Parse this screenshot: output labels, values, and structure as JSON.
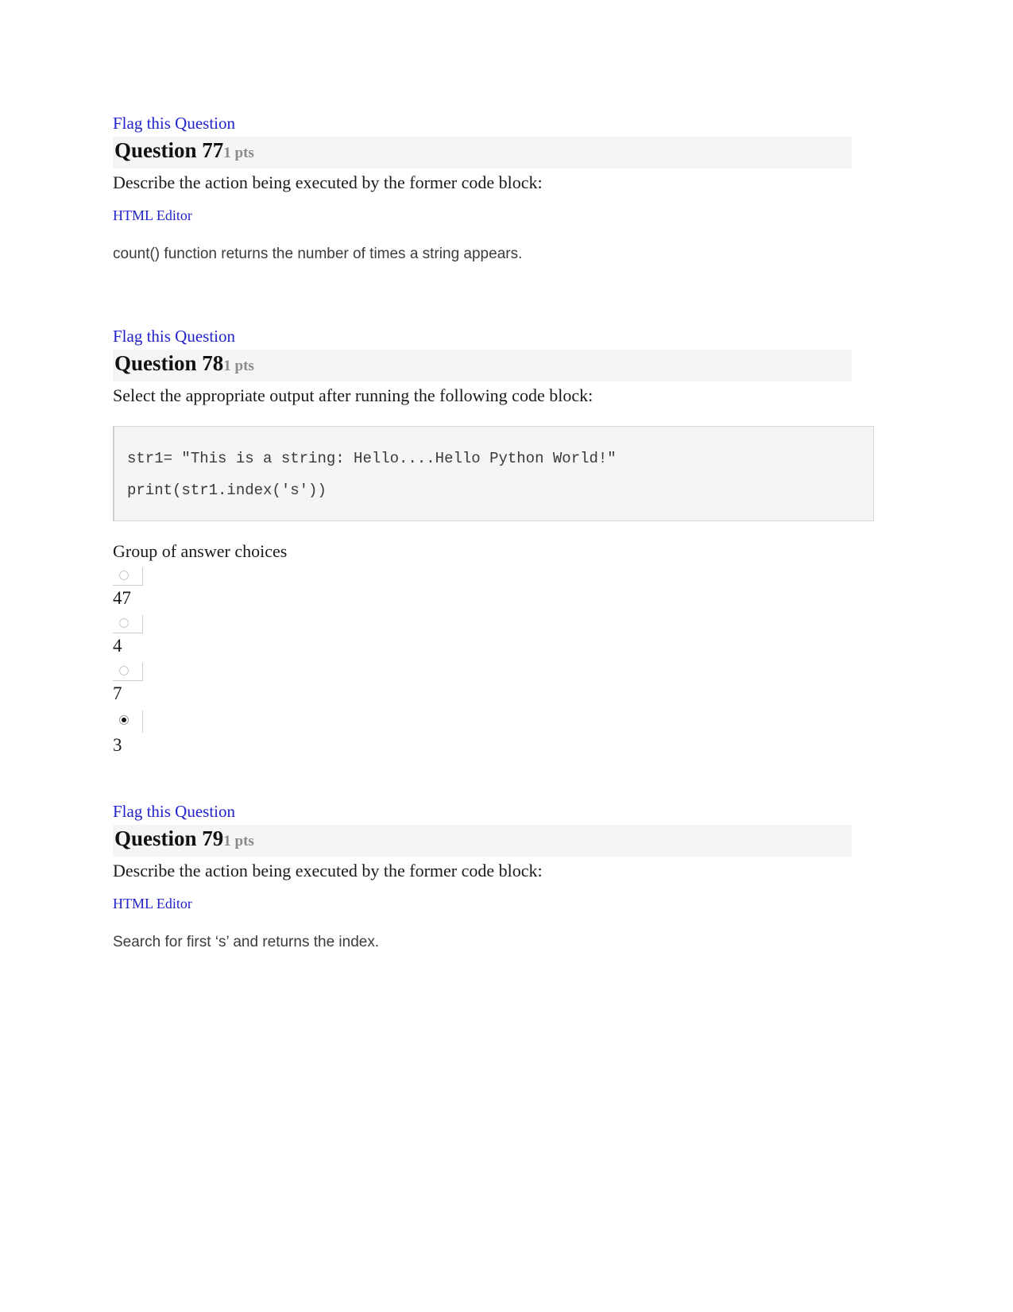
{
  "page": {
    "background": "#ffffff",
    "link_color": "#2222cc",
    "header_bar_color": "#f5f5f5",
    "points_color": "#8a8a8a",
    "code_bg": "#f5f5f5",
    "code_border": "#d8d8d8"
  },
  "questions": [
    {
      "flag_label": "Flag this Question",
      "title": "Question 77",
      "points": "1 pts",
      "prompt": "Describe the action being executed by the former code block:",
      "editor_label": "HTML Editor",
      "answer": "count() function returns the number of times a string appears."
    },
    {
      "flag_label": "Flag this Question",
      "title": "Question 78",
      "points": "1 pts",
      "prompt": "Select the appropriate output after running the following code block:",
      "code": {
        "line1": "str1= \"This is a string: Hello....Hello Python World!\"",
        "line2": "print(str1.index('s'))"
      },
      "choices_label": "Group of answer choices",
      "choices": [
        {
          "label": "47",
          "selected": false
        },
        {
          "label": "4",
          "selected": false
        },
        {
          "label": "7",
          "selected": false
        },
        {
          "label": "3",
          "selected": true
        }
      ]
    },
    {
      "flag_label": "Flag this Question",
      "title": "Question 79",
      "points": "1 pts",
      "prompt": "Describe the action being executed by the former code block:",
      "editor_label": "HTML Editor",
      "answer": "Search for first ‘s’ and returns the index."
    }
  ]
}
